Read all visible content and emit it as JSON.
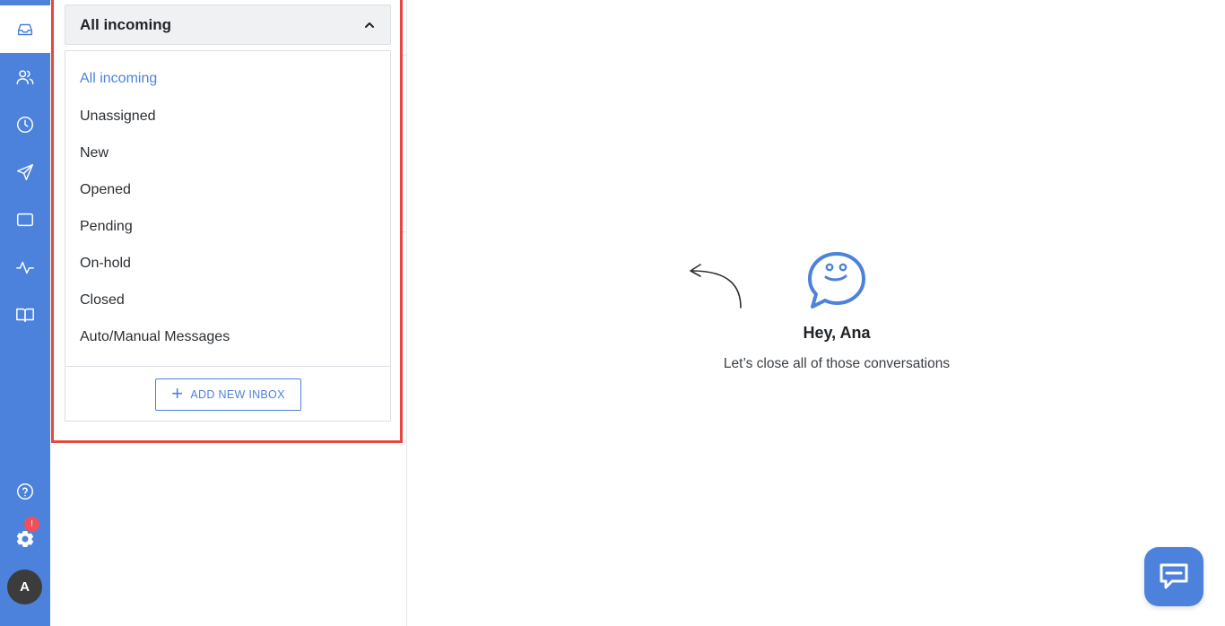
{
  "rail": {
    "items": [
      {
        "icon": "inbox-icon",
        "active": true
      },
      {
        "icon": "contacts-icon"
      },
      {
        "icon": "clock-icon"
      },
      {
        "icon": "send-icon"
      },
      {
        "icon": "window-icon"
      },
      {
        "icon": "activity-icon"
      },
      {
        "icon": "book-icon"
      },
      {
        "icon": "help-icon"
      },
      {
        "icon": "settings-icon"
      }
    ],
    "settings_badge": "!",
    "avatar_initial": "A"
  },
  "inbox_dropdown": {
    "selected": "All incoming",
    "options": [
      "All incoming",
      "Unassigned",
      "New",
      "Opened",
      "Pending",
      "On-hold",
      "Closed",
      "Auto/Manual Messages"
    ],
    "add_button_label": "ADD NEW INBOX"
  },
  "empty_state": {
    "greeting": "Hey, Ana",
    "message": "Let’s close all of those conversations"
  },
  "colors": {
    "accent": "#4d82dc",
    "highlight_border": "#e8463f",
    "badge": "#f0505a"
  }
}
